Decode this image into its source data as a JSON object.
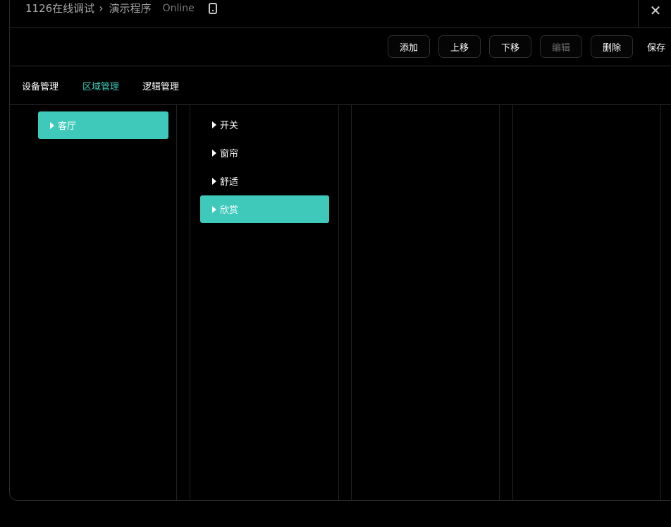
{
  "header": {
    "project": "1126在线调试",
    "program": "演示程序",
    "status": "Online",
    "icons": {
      "separator": "chevron-right-icon",
      "device": "device-icon",
      "close": "close-icon"
    }
  },
  "toolbar": {
    "add": "添加",
    "move_up": "上移",
    "move_down": "下移",
    "edit": "编辑",
    "delete": "删除",
    "save": "保存"
  },
  "tabs": [
    {
      "label": "设备管理",
      "active": false
    },
    {
      "label": "区域管理",
      "active": true
    },
    {
      "label": "逻辑管理",
      "active": false
    }
  ],
  "areas": [
    {
      "label": "客厅",
      "selected": true
    }
  ],
  "scenes": [
    {
      "label": "开关",
      "selected": false
    },
    {
      "label": "窗帘",
      "selected": false
    },
    {
      "label": "舒适",
      "selected": false
    },
    {
      "label": "欣赏",
      "selected": true
    }
  ],
  "colors": {
    "accent": "#3ec9bb",
    "background": "#000000",
    "border": "#2a2a2e",
    "muted_text": "#a8a8ad",
    "disabled_text": "#6b6b70"
  }
}
